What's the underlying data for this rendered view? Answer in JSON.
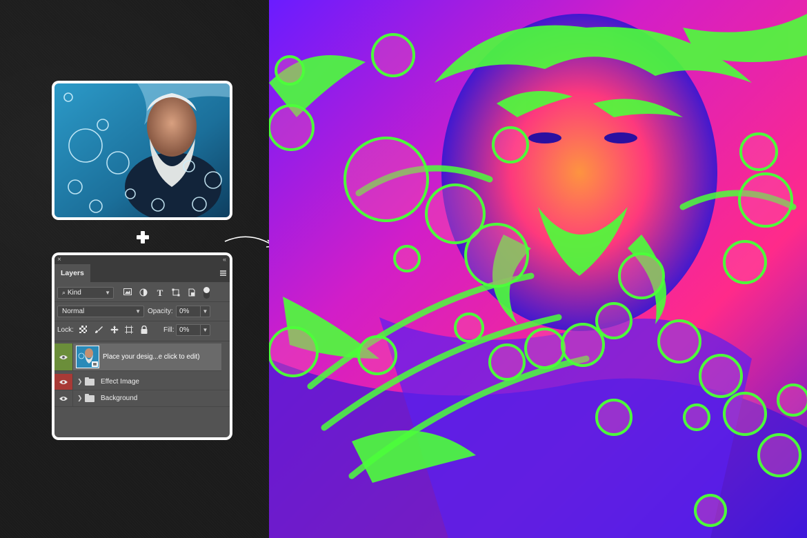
{
  "source_photo": {
    "alt_icon": "portrait-photo"
  },
  "plus_sign": "+",
  "layers_panel": {
    "close_glyph": "×",
    "collapse_glyph": "«",
    "tab_label": "Layers",
    "filter": {
      "label": "Kind",
      "icons": [
        "image-filter-icon",
        "adjustment-filter-icon",
        "type-filter-icon",
        "shape-filter-icon",
        "smart-object-filter-icon",
        "filter-toggle-icon"
      ]
    },
    "blend_mode": "Normal",
    "opacity_label": "Opacity:",
    "opacity_value": "0%",
    "lock_label": "Lock:",
    "fill_label": "Fill:",
    "fill_value": "0%",
    "layers": [
      {
        "name": "Place your desig...e click to edit)",
        "type": "smart-object",
        "selected": true,
        "eye_color": "#6b8e3a"
      },
      {
        "name": "Effect Image",
        "type": "group",
        "selected": false,
        "eye_color": "#a83a36"
      },
      {
        "name": "Background",
        "type": "group",
        "selected": false,
        "eye_color": "#535353"
      }
    ]
  },
  "colors": {
    "page_bg": "#1c1c1c",
    "panel_bg": "#535353",
    "accent_magenta": "#ff2a8a",
    "accent_blue": "#3a1ad8",
    "accent_green": "#4cff3a"
  }
}
